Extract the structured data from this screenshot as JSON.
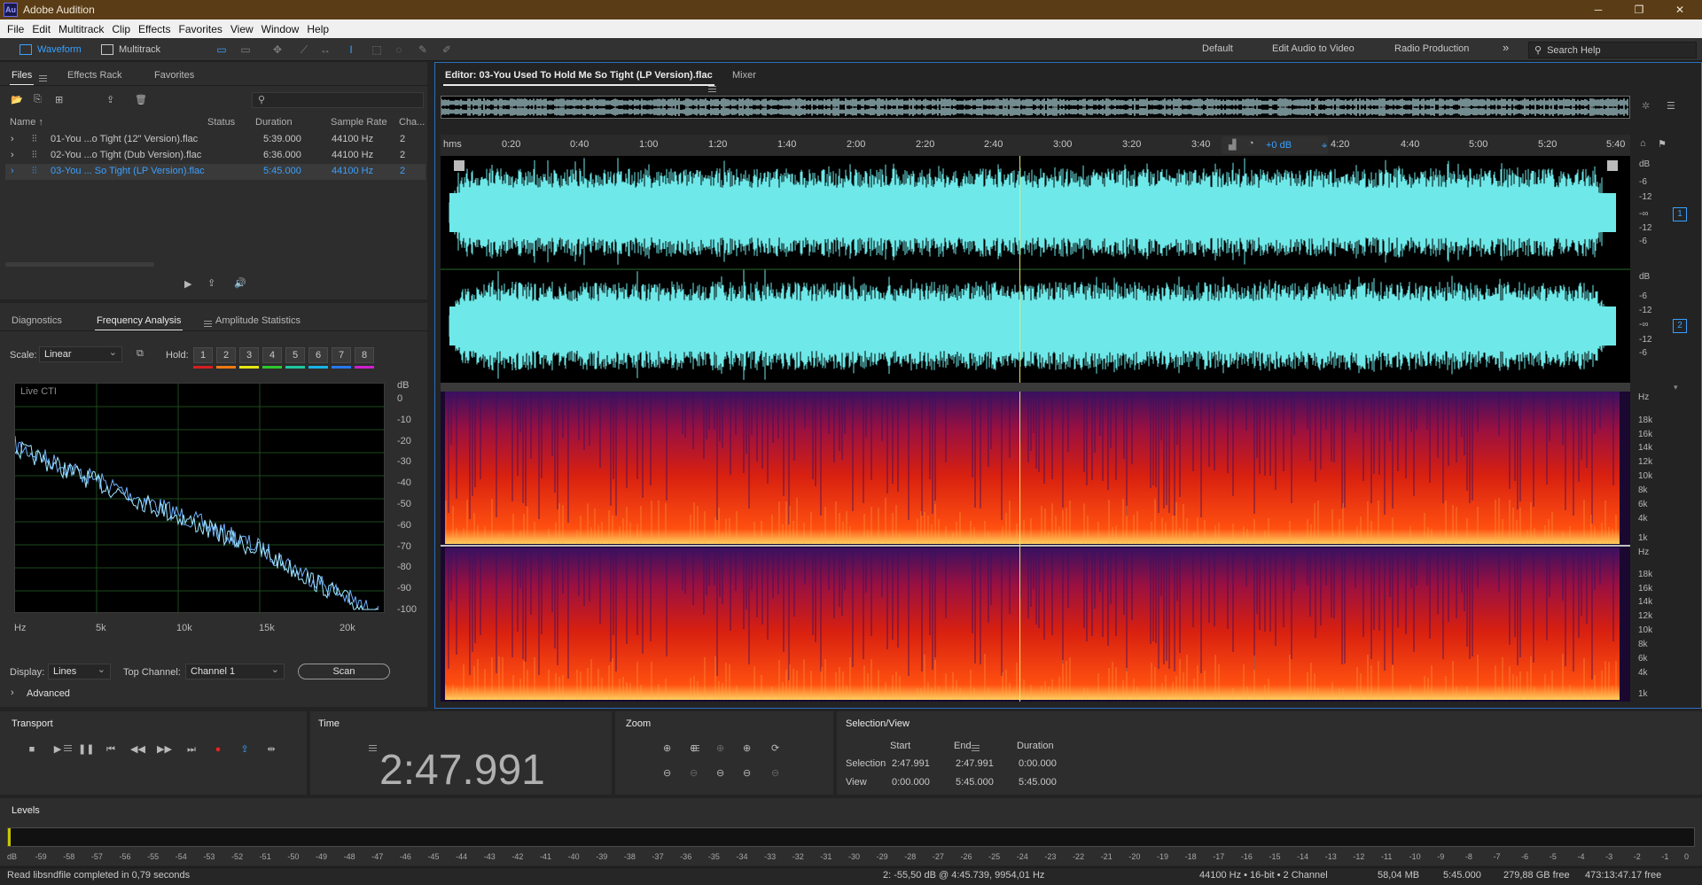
{
  "titlebar": {
    "app_icon": "Au",
    "title": "Adobe Audition",
    "minimize": "─",
    "maximize": "❐",
    "close": "✕"
  },
  "menu": [
    "File",
    "Edit",
    "Multitrack",
    "Clip",
    "Effects",
    "Favorites",
    "View",
    "Window",
    "Help"
  ],
  "toolbar": {
    "waveform": "Waveform",
    "multitrack": "Multitrack",
    "workspaces": [
      "Default",
      "Edit Audio to Video",
      "Radio Production"
    ],
    "more": "»",
    "search_placeholder": "Search Help"
  },
  "files_panel": {
    "tabs": [
      "Files",
      "Effects Rack",
      "Favorites"
    ],
    "columns": [
      "Name ↑",
      "Status",
      "Duration",
      "Sample Rate",
      "Cha..."
    ],
    "rows": [
      {
        "name": "01-You ...o Tight (12\" Version).flac",
        "status": "",
        "duration": "5:39.000",
        "rate": "44100 Hz",
        "ch": "2"
      },
      {
        "name": "02-You ...o Tight (Dub Version).flac",
        "status": "",
        "duration": "6:36.000",
        "rate": "44100 Hz",
        "ch": "2"
      },
      {
        "name": "03-You ... So Tight (LP Version).flac",
        "status": "",
        "duration": "5:45.000",
        "rate": "44100 Hz",
        "ch": "2"
      }
    ]
  },
  "analysis_panel": {
    "tabs": [
      "Diagnostics",
      "Frequency Analysis",
      "Amplitude Statistics"
    ],
    "scale_label": "Scale:",
    "scale_value": "Linear",
    "hold_label": "Hold:",
    "hold_buttons": [
      "1",
      "2",
      "3",
      "4",
      "5",
      "6",
      "7",
      "8"
    ],
    "hold_colors": [
      "#d81e1e",
      "#f07a12",
      "#e6e614",
      "#2cc82c",
      "#1ec8a0",
      "#18b4e6",
      "#2878f0",
      "#d01ed0"
    ],
    "graph_label": "Live CTI",
    "db_unit": "dB",
    "db_ticks": [
      "0",
      "-10",
      "-20",
      "-30",
      "-40",
      "-50",
      "-60",
      "-70",
      "-80",
      "-90",
      "-100"
    ],
    "hz_ticks": [
      "Hz",
      "5k",
      "10k",
      "15k",
      "20k"
    ],
    "display_label": "Display:",
    "display_value": "Lines",
    "top_channel_label": "Top Channel:",
    "top_channel_value": "Channel 1",
    "scan_label": "Scan",
    "advanced_label": "Advanced"
  },
  "editor": {
    "tab_title": "Editor: 03-You Used To Hold Me So Tight (LP Version).flac",
    "mixer_tab": "Mixer",
    "ruler_labels": [
      "hms",
      "0:20",
      "0:40",
      "1:00",
      "1:20",
      "1:40",
      "2:00",
      "2:20",
      "2:40",
      "3:00",
      "3:20",
      "3:40",
      "4:20",
      "4:40",
      "5:00",
      "5:20",
      "5:40"
    ],
    "hud_gain": "+0 dB",
    "channel1_db": [
      "dB",
      "-6",
      "-12",
      "-∞",
      "-12",
      "-6"
    ],
    "channel2_db": [
      "dB",
      "-6",
      "-12",
      "-∞",
      "-12",
      "-6"
    ],
    "channel_badges": [
      "1",
      "2"
    ],
    "spectral_hz_1": [
      "Hz",
      "18k",
      "16k",
      "14k",
      "12k",
      "10k",
      "8k",
      "6k",
      "4k",
      "1k"
    ],
    "spectral_hz_2": [
      "Hz",
      "18k",
      "16k",
      "14k",
      "12k",
      "10k",
      "8k",
      "6k",
      "4k",
      "1k"
    ],
    "playhead_fraction": 0.487
  },
  "transport": {
    "title": "Transport"
  },
  "time": {
    "title": "Time",
    "value": "2:47.991"
  },
  "zoom": {
    "title": "Zoom"
  },
  "selection_view": {
    "title": "Selection/View",
    "headers": [
      "Start",
      "End",
      "Duration"
    ],
    "selection_label": "Selection",
    "selection": [
      "2:47.991",
      "2:47.991",
      "0:00.000"
    ],
    "view_label": "View",
    "view": [
      "0:00.000",
      "5:45.000",
      "5:45.000"
    ]
  },
  "levels": {
    "title": "Levels",
    "scale": [
      "dB",
      "-59",
      "-58",
      "-57",
      "-56",
      "-55",
      "-54",
      "-53",
      "-52",
      "-51",
      "-50",
      "-49",
      "-48",
      "-47",
      "-46",
      "-45",
      "-44",
      "-43",
      "-42",
      "-41",
      "-40",
      "-39",
      "-38",
      "-37",
      "-36",
      "-35",
      "-34",
      "-33",
      "-32",
      "-31",
      "-30",
      "-29",
      "-28",
      "-27",
      "-26",
      "-25",
      "-24",
      "-23",
      "-22",
      "-21",
      "-20",
      "-19",
      "-18",
      "-17",
      "-16",
      "-15",
      "-14",
      "-13",
      "-12",
      "-11",
      "-10",
      "-9",
      "-8",
      "-7",
      "-6",
      "-5",
      "-4",
      "-3",
      "-2",
      "-1",
      "0"
    ]
  },
  "statusbar": {
    "left": "Read libsndfile completed in 0,79 seconds",
    "cursor": "2: -55,50 dB @ 4:45.739, 9954,01 Hz",
    "format": "44100 Hz • 16-bit • 2 Channel",
    "size": "58,04 MB",
    "duration": "5:45.000",
    "free": "279,88 GB free",
    "free_time": "473:13:47.17 free"
  },
  "colors": {
    "accent": "#39a0ff",
    "waveform": "#6ee8e8",
    "playhead": "#e8e86a"
  }
}
